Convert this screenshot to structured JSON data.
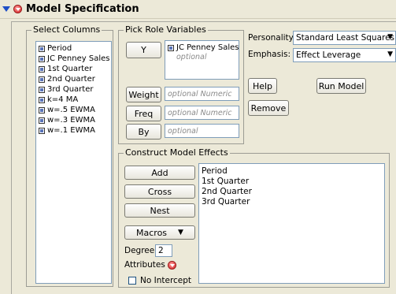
{
  "header": {
    "title": "Model Specification"
  },
  "select_columns": {
    "legend": "Select Columns",
    "items": [
      "Period",
      "JC Penney Sales",
      "1st Quarter",
      "2nd Quarter",
      "3rd Quarter",
      "k=4 MA",
      "w=.5 EWMA",
      "w=.3 EWMA",
      "w=.1 EWMA"
    ]
  },
  "pick_role": {
    "legend": "Pick Role Variables",
    "y_label": "Y",
    "y_value": "JC Penney Sales",
    "y_placeholder": "optional",
    "weight_label": "Weight",
    "weight_placeholder": "optional Numeric",
    "freq_label": "Freq",
    "freq_placeholder": "optional Numeric",
    "by_label": "By",
    "by_placeholder": "optional"
  },
  "settings": {
    "personality_label": "Personality:",
    "personality_value": "Standard Least Squares",
    "emphasis_label": "Emphasis:",
    "emphasis_value": "Effect Leverage"
  },
  "actions": {
    "help": "Help",
    "run": "Run Model",
    "remove": "Remove"
  },
  "construct": {
    "legend": "Construct Model Effects",
    "add": "Add",
    "cross": "Cross",
    "nest": "Nest",
    "macros": "Macros",
    "degree_label": "Degree",
    "degree_value": "2",
    "attributes_label": "Attributes",
    "no_intercept_label": "No Intercept",
    "effects": [
      "Period",
      "1st Quarter",
      "2nd Quarter",
      "3rd Quarter"
    ]
  }
}
